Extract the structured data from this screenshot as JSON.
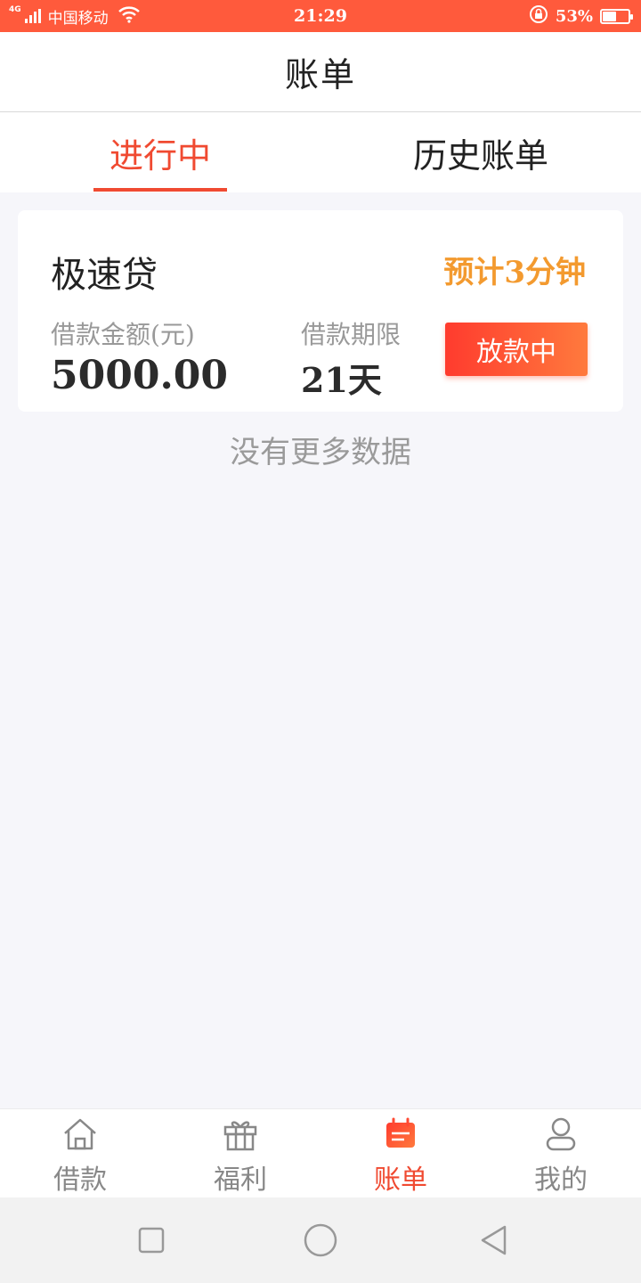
{
  "status_bar": {
    "network": "4G",
    "carrier": "中国移动",
    "time": "21:29",
    "battery_percent": "53%",
    "battery_level": 0.53
  },
  "header": {
    "title": "账单"
  },
  "tabs": [
    {
      "label": "进行中",
      "active": true
    },
    {
      "label": "历史账单",
      "active": false
    }
  ],
  "loan_card": {
    "product": "极速贷",
    "eta": "预计3分钟",
    "amount_label": "借款金额(元)",
    "amount_value": "5000.00",
    "term_label": "借款期限",
    "term_value": "21天",
    "status_button": "放款中"
  },
  "list_footer": "没有更多数据",
  "bottom_nav": [
    {
      "label": "借款",
      "icon": "home-icon",
      "active": false
    },
    {
      "label": "福利",
      "icon": "gift-icon",
      "active": false
    },
    {
      "label": "账单",
      "icon": "bill-icon",
      "active": true
    },
    {
      "label": "我的",
      "icon": "user-icon",
      "active": false
    }
  ],
  "colors": {
    "accent": "#f04a31",
    "status_bar": "#ff5a3c",
    "eta": "#f39a2f",
    "inactive": "#888888"
  }
}
